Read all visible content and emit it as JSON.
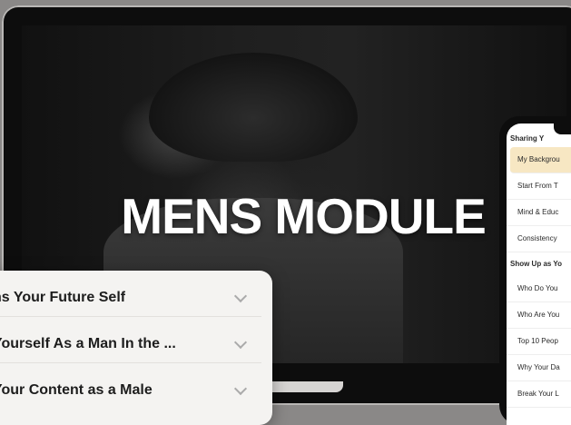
{
  "hero": {
    "title": "MENS MODULE"
  },
  "card": {
    "rows": [
      {
        "label": "ns Your Future Self"
      },
      {
        "label": "Yourself As a Man In the ..."
      },
      {
        "label": "Your Content as a Male"
      }
    ]
  },
  "phone": {
    "header": "Sharing Y",
    "items_a": [
      {
        "label": "My Backgrou"
      },
      {
        "label": "Start From T"
      },
      {
        "label": "Mind & Educ"
      },
      {
        "label": "Consistency"
      }
    ],
    "section": "Show Up as Yo",
    "items_b": [
      {
        "label": "Who Do You"
      },
      {
        "label": "Who Are You"
      },
      {
        "label": "Top 10 Peop"
      },
      {
        "label": "Why Your Da"
      },
      {
        "label": "Break Your L"
      }
    ]
  }
}
